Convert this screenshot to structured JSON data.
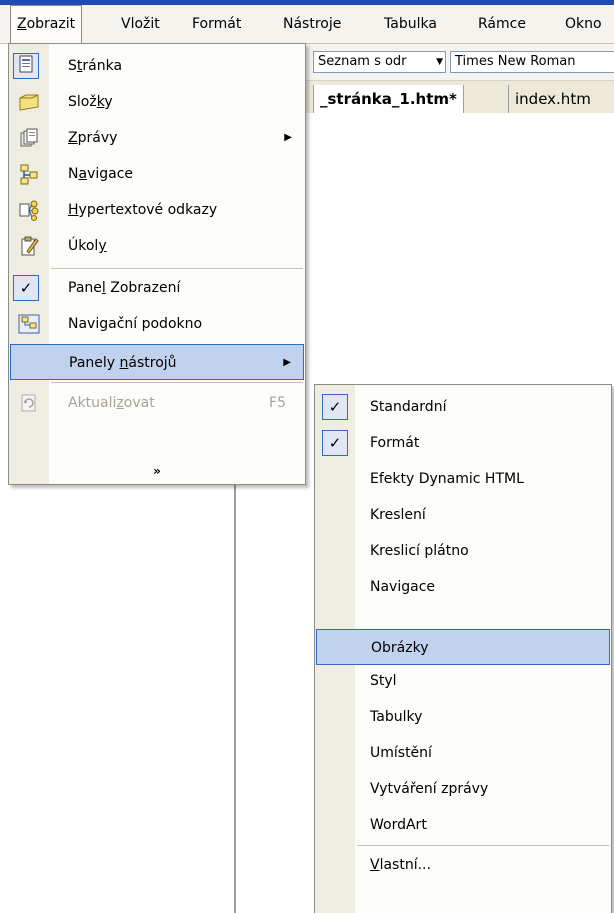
{
  "menubar": {
    "items": [
      {
        "label": "Zobrazit",
        "accel": "Z"
      },
      {
        "label": "Vložit",
        "accel": "l"
      },
      {
        "label": "Formát",
        "accel": "F"
      },
      {
        "label": "Nástroje",
        "accel": "N"
      },
      {
        "label": "Tabulka",
        "accel": "T"
      },
      {
        "label": "Rámce",
        "accel": "R"
      },
      {
        "label": "Okno",
        "accel": "O"
      }
    ]
  },
  "toolbar": {
    "style_combo": "Seznam s odr",
    "font_combo": "Times New Roman"
  },
  "doc_tabs": [
    {
      "label": "_stránka_1.htm*",
      "active": true
    },
    {
      "label": "index.htm",
      "active": false
    }
  ],
  "view_menu": {
    "items": [
      {
        "pre": "S",
        "u": "t",
        "post": "ránka",
        "icon": "page-icon",
        "checked": false
      },
      {
        "pre": "Slož",
        "u": "k",
        "post": "y",
        "icon": "folder-icon",
        "checked": false
      },
      {
        "pre": "",
        "u": "Z",
        "post": "právy",
        "icon": "reports-icon",
        "submenu": true
      },
      {
        "pre": "N",
        "u": "a",
        "post": "vigace",
        "icon": "navigation-icon"
      },
      {
        "pre": "",
        "u": "H",
        "post": "ypertextové odkazy",
        "icon": "hyperlinks-icon"
      },
      {
        "pre": "Úkol",
        "u": "y",
        "post": "",
        "icon": "tasks-icon"
      },
      {
        "pre": "Pane",
        "u": "l",
        "post": " Zobrazení",
        "icon": "check-icon",
        "checked": true
      },
      {
        "pre": "Navigační podokno",
        "u": "",
        "post": "",
        "icon": "navigation-pane-icon"
      },
      {
        "pre": "Panely ",
        "u": "n",
        "post": "ástrojů",
        "submenu": true,
        "highlighted": true
      },
      {
        "pre": "Aktuali",
        "u": "z",
        "post": "ovat",
        "shortcut": "F5",
        "icon": "refresh-icon",
        "disabled": true
      }
    ],
    "more": "»"
  },
  "toolbars_submenu": {
    "items": [
      {
        "label": "Standardní",
        "checked": true
      },
      {
        "label": "Formát",
        "checked": true
      },
      {
        "label": "Efekty Dynamic HTML"
      },
      {
        "label": "Kreslení"
      },
      {
        "label": "Kreslicí plátno"
      },
      {
        "label": "Navigace"
      },
      {
        "label": "Obrázky",
        "highlighted": true
      },
      {
        "label": "Styl"
      },
      {
        "label": "Tabulky"
      },
      {
        "label": "Umístění"
      },
      {
        "label": "Vytváření zprávy"
      },
      {
        "label": "WordArt"
      },
      {
        "pre": "",
        "u": "V",
        "post": "lastní..."
      }
    ]
  },
  "colors": {
    "highlight_fill": "#c1d2ee",
    "highlight_border": "#316ac5",
    "menu_bg": "#fcfcf9",
    "icon_strip": "#efede2",
    "title_blue": "#1f4bb4"
  }
}
